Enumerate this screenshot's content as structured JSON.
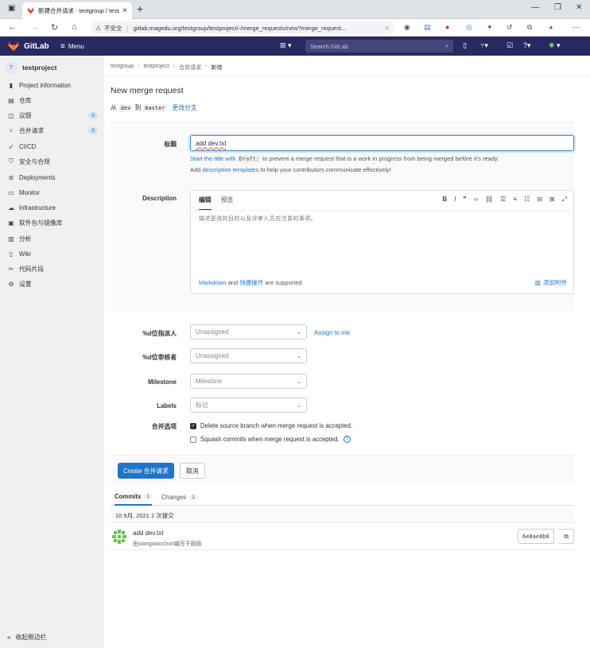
{
  "browser": {
    "tab_title": "新建合并请求 · testgroup / testp",
    "security_label": "不安全",
    "url": "gitlab.magedu.org/testgroup/testproject/-/merge_requests/new?merge_request..."
  },
  "header": {
    "app_name": "GitLab",
    "menu_label": "Menu",
    "search_placeholder": "Search GitLab"
  },
  "sidebar": {
    "project_initial": "T",
    "project_name": "testproject",
    "items": [
      {
        "label": "Project information",
        "icon": "info-icon"
      },
      {
        "label": "仓库",
        "icon": "repo-icon"
      },
      {
        "label": "议题",
        "icon": "issues-icon",
        "count": "0"
      },
      {
        "label": "合并请求",
        "icon": "merge-request-icon",
        "count": "0"
      },
      {
        "label": "CI/CD",
        "icon": "rocket-icon"
      },
      {
        "label": "安全与合规",
        "icon": "shield-icon"
      },
      {
        "label": "Deployments",
        "icon": "deployments-icon"
      },
      {
        "label": "Monitor",
        "icon": "monitor-icon"
      },
      {
        "label": "Infrastructure",
        "icon": "cloud-icon"
      },
      {
        "label": "软件包与镜像库",
        "icon": "package-icon"
      },
      {
        "label": "分析",
        "icon": "chart-icon"
      },
      {
        "label": "Wiki",
        "icon": "book-icon"
      },
      {
        "label": "代码片段",
        "icon": "snippet-icon"
      },
      {
        "label": "设置",
        "icon": "settings-icon"
      }
    ],
    "collapse_label": "收起侧边栏"
  },
  "breadcrumb": [
    "testgroup",
    "testproject",
    "合并请求",
    "新增"
  ],
  "page": {
    "title": "New merge request",
    "from_prefix": "从",
    "source_branch": "dev",
    "to_word": "到",
    "target_branch": "master",
    "change_branches": "更改分支"
  },
  "form": {
    "title_label": "标题",
    "title_value": "add dev.txt",
    "hint1_a": "Start the title with",
    "hint1_code": "Draft:",
    "hint1_b": "to prevent a merge request that is a work in progress from being merged before it's ready.",
    "hint2_a": "Add",
    "hint2_link": "description templates",
    "hint2_b": "to help your contributors communicate effectively!",
    "description_label": "Description",
    "editor_tab_write": "编辑",
    "editor_tab_preview": "预览",
    "editor_placeholder": "描述更改的目的以及评审人员应注意的事项。",
    "markdown_link": "Markdown",
    "and_word": "and",
    "quick_actions": "快捷操作",
    "supported": "are supported",
    "attach_file": "添加附件",
    "assignee_label": "%d位指派人",
    "assignee_value": "Unassigned",
    "assign_to_me": "Assign to me",
    "reviewer_label": "%d位审核者",
    "reviewer_value": "Unassigned",
    "milestone_label": "Milestone",
    "milestone_value": "Milestone",
    "labels_label": "Labels",
    "labels_value": "标记",
    "merge_options_label": "合并选项",
    "delete_source_branch": "Delete source branch when merge request is accepted.",
    "squash_commits": "Squash commits when merge request is accepted.",
    "create_button": "Create 合并请求",
    "cancel_button": "取消"
  },
  "commits_tabs": {
    "commits_label": "Commits",
    "commits_count": "1",
    "changes_label": "Changes",
    "changes_count": "1"
  },
  "commits": {
    "day_header": "10 9月, 2021 1 次提交",
    "message": "add dev.txt",
    "author_line": "由wangxiaochun编写于刚刚",
    "sha": "6e8ae8b0"
  },
  "colors": {
    "header_bg": "#292961",
    "accent": "#1f75cb",
    "sidebar_bg": "#f0f0f0"
  }
}
